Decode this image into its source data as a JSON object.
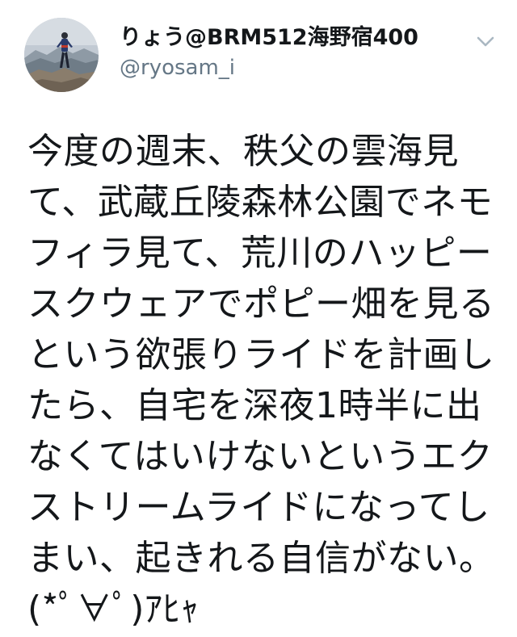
{
  "user": {
    "display_name": "りょう@BRM512海野宿400",
    "handle": "@ryosam_i",
    "avatar_icon": "profile-photo-icon"
  },
  "menu": {
    "icon": "chevron-down-icon"
  },
  "tweet": {
    "lines": [
      "今度の週末、秩父の雲海見",
      "て、武蔵丘陵森林公園でネモ",
      "フィラ見て、荒川のハッピー",
      "スクウェアでポピー畑を見る",
      "という欲張りライドを計画し",
      "たら、自宅を深夜1時半に出",
      "なくてはいけないというエク",
      "ストリームライドになってし",
      "まい、起きれる自信がない。",
      "(*ﾟ∀ﾟ)ｱﾋｬ"
    ]
  },
  "colors": {
    "text": "#14171a",
    "secondary": "#657786",
    "caret": "#aab8c2"
  }
}
